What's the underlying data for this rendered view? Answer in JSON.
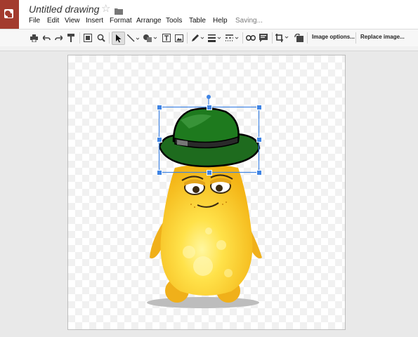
{
  "app": {
    "title": "Untitled drawing",
    "status": "Saving..."
  },
  "menu": [
    "File",
    "Edit",
    "View",
    "Insert",
    "Format",
    "Arrange",
    "Tools",
    "Table",
    "Help"
  ],
  "toolbar": {
    "image_options_label": "Image options...",
    "replace_image_label": "Replace image...",
    "icons": [
      "print-icon",
      "undo-icon",
      "redo-icon",
      "paint-format-icon",
      "zoom-fit-icon",
      "zoom-icon",
      "select-cursor-icon",
      "line-icon",
      "shape-icon",
      "text-box-icon",
      "image-icon",
      "pen-color-icon",
      "line-weight-icon",
      "line-dash-icon",
      "link-icon",
      "comment-icon",
      "crop-icon",
      "reset-image-icon"
    ]
  },
  "colors": {
    "brand": "#a33b2e",
    "selection": "#3f84e4",
    "hat": "#1e6b1e",
    "monster": "#f6c21b"
  }
}
